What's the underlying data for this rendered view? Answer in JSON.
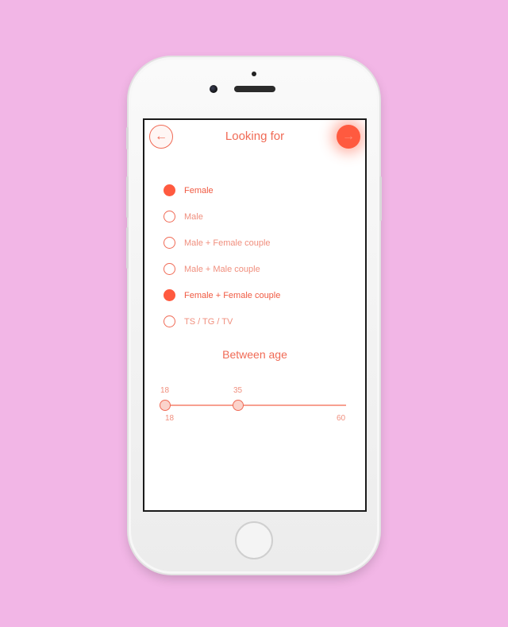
{
  "header": {
    "title": "Looking for",
    "back_icon": "←",
    "next_icon": "→"
  },
  "options": [
    {
      "label": "Female",
      "checked": true
    },
    {
      "label": "Male",
      "checked": false
    },
    {
      "label": "Male + Female couple",
      "checked": false
    },
    {
      "label": "Male + Male couple",
      "checked": false
    },
    {
      "label": "Female + Female couple",
      "checked": true
    },
    {
      "label": "TS / TG / TV",
      "checked": false
    }
  ],
  "age": {
    "title": "Between age",
    "selected_min": "18",
    "selected_max": "35",
    "range_min": "18",
    "range_max": "60"
  },
  "colors": {
    "accent": "#ff5a3f",
    "background": "#f2b6e6"
  }
}
